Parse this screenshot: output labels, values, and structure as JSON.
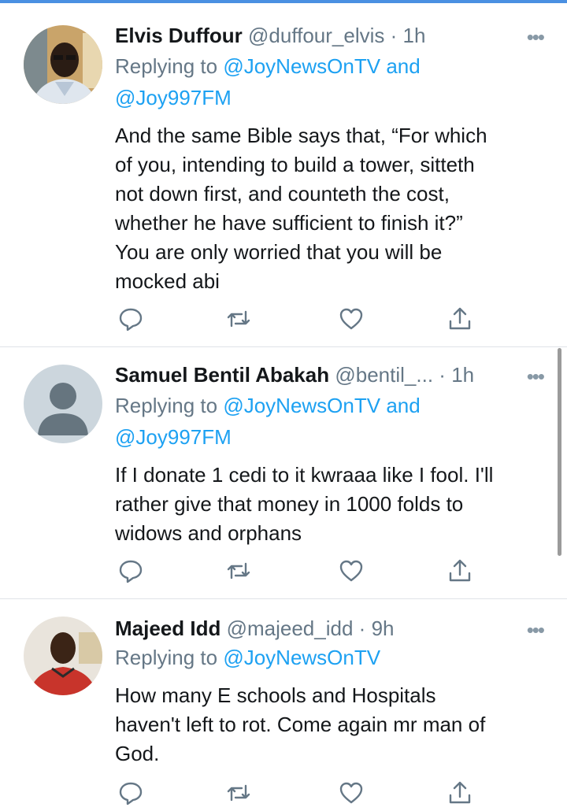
{
  "tweets": [
    {
      "name": "Elvis Duffour",
      "handle": "@duffour_elvis",
      "sep": "·",
      "time": "1h",
      "more": "•••",
      "replying_prefix": "Replying to",
      "reply_to_1": "@JoyNewsOnTV",
      "reply_and": "and",
      "reply_to_2": "@Joy997FM",
      "text_lines": [
        "And the same Bible says that, “For which",
        "of you, intending to build a tower, sitteth",
        "not down first, and counteth the cost,",
        "whether he have sufficient to finish it?”",
        "You are only worried that you will be",
        "mocked abi"
      ]
    },
    {
      "name": "Samuel Bentil Abakah",
      "handle": "@bentil_...",
      "sep": "·",
      "time": "1h",
      "more": "•••",
      "replying_prefix": "Replying to",
      "reply_to_1": "@JoyNewsOnTV",
      "reply_and": "and",
      "reply_to_2": "@Joy997FM",
      "text_lines": [
        "If I donate 1 cedi to it kwraaa like I fool. I'll",
        "rather give that money in 1000 folds to",
        "widows and orphans"
      ]
    },
    {
      "name": "Majeed Idd",
      "handle": "@majeed_idd",
      "sep": "·",
      "time": "9h",
      "more": "•••",
      "replying_prefix": "Replying to",
      "reply_to_1": "@JoyNewsOnTV",
      "text_lines": [
        "How many E schools and Hospitals",
        "haven't left to rot. Come again mr man of",
        "God."
      ]
    }
  ],
  "icons": {
    "reply": "reply-icon",
    "retweet": "retweet-icon",
    "like": "heart-icon",
    "share": "share-icon"
  },
  "colors": {
    "link": "#1da1f2",
    "secondary_text": "#657786",
    "primary_text": "#14171a",
    "icon": "#657786",
    "top_bar": "#4a90e2"
  }
}
